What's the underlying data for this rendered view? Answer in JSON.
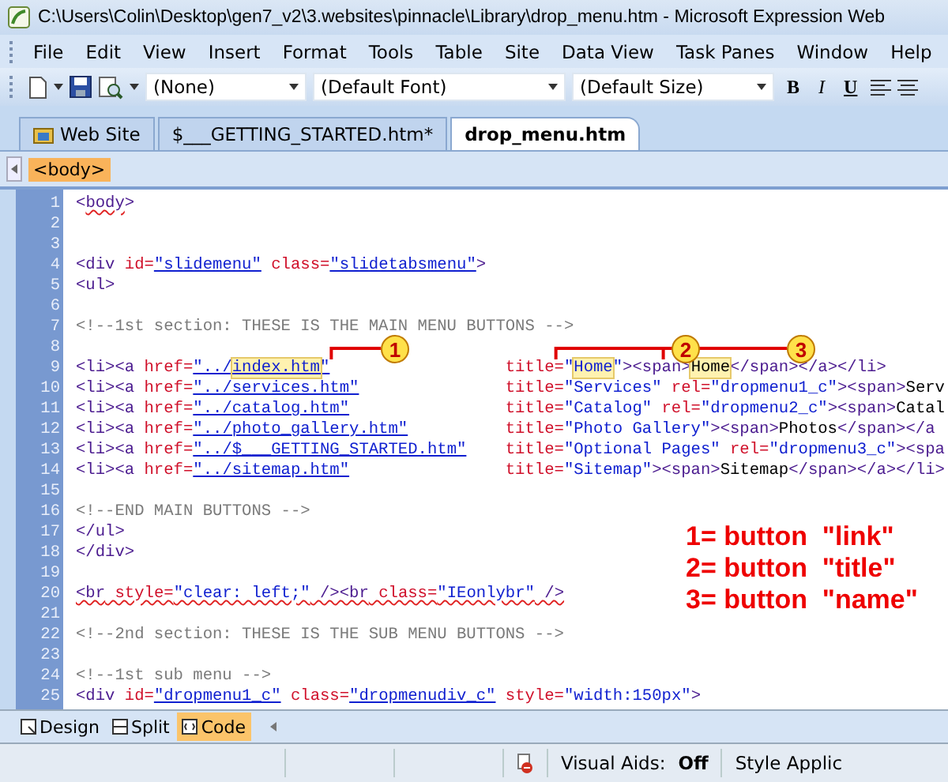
{
  "window": {
    "title": "C:\\Users\\Colin\\Desktop\\gen7_v2\\3.websites\\pinnacle\\Library\\drop_menu.htm - Microsoft Expression Web"
  },
  "menu": [
    "File",
    "Edit",
    "View",
    "Insert",
    "Format",
    "Tools",
    "Table",
    "Site",
    "Data View",
    "Task Panes",
    "Window",
    "Help"
  ],
  "toolbar": {
    "style": "(None)",
    "font": "(Default Font)",
    "size": "(Default Size)",
    "format_buttons": [
      "B",
      "I",
      "U"
    ]
  },
  "tabs": [
    {
      "label": "Web Site",
      "kind": "site",
      "selected": false
    },
    {
      "label": "$___GETTING_STARTED.htm*",
      "kind": "file",
      "selected": false
    },
    {
      "label": "drop_menu.htm",
      "kind": "file",
      "selected": true
    }
  ],
  "breadcrumb": "<body>",
  "code_lines": [
    {
      "n": "1",
      "segments": [
        {
          "kind": "tag",
          "text": "<"
        },
        {
          "kind": "tag",
          "text": "body",
          "squiggle": true
        },
        {
          "kind": "tag",
          "text": ">"
        }
      ]
    },
    {
      "n": "2"
    },
    {
      "n": "3"
    },
    {
      "n": "4",
      "segments": [
        {
          "kind": "tag",
          "text": "<div"
        },
        {
          "kind": "attr",
          "text": " id="
        },
        {
          "kind": "link",
          "text": "\"slidemenu\""
        },
        {
          "kind": "attr",
          "text": " class="
        },
        {
          "kind": "link",
          "text": "\"slidetabsmenu\""
        },
        {
          "kind": "tag",
          "text": ">"
        }
      ]
    },
    {
      "n": "5",
      "segments": [
        {
          "kind": "tag",
          "text": "<ul>"
        }
      ]
    },
    {
      "n": "6"
    },
    {
      "n": "7",
      "segments": [
        {
          "kind": "comment",
          "text": "<!--1st section: THESE IS THE MAIN MENU BUTTONS -->"
        }
      ]
    },
    {
      "n": "8"
    },
    {
      "n": "9",
      "segments": [
        {
          "kind": "tag",
          "text": "<li><a"
        },
        {
          "kind": "attr",
          "text": " href="
        },
        {
          "kind": "link",
          "text": "\"../"
        },
        {
          "kind": "link",
          "text": "index.htm",
          "highlight": true
        },
        {
          "kind": "link",
          "text": "\""
        }
      ],
      "column_2": [
        {
          "kind": "attr",
          "text": "title="
        },
        {
          "kind": "value",
          "text": "\""
        },
        {
          "kind": "value",
          "text": "Home",
          "highlight": true
        },
        {
          "kind": "value",
          "text": "\""
        },
        {
          "kind": "tag",
          "text": "><span>"
        },
        {
          "kind": "text",
          "text": "Home",
          "highlight": true
        },
        {
          "kind": "tag",
          "text": "</span></a></li>"
        }
      ]
    },
    {
      "n": "10",
      "segments": [
        {
          "kind": "tag",
          "text": "<li><a"
        },
        {
          "kind": "attr",
          "text": " href="
        },
        {
          "kind": "link",
          "text": "\"../services.htm\""
        }
      ],
      "column_2": [
        {
          "kind": "attr",
          "text": "title="
        },
        {
          "kind": "value",
          "text": "\"Services\""
        },
        {
          "kind": "attr",
          "text": " rel="
        },
        {
          "kind": "value",
          "text": "\"dropmenu1_c\""
        },
        {
          "kind": "tag",
          "text": "><span>"
        },
        {
          "kind": "text",
          "text": "Serv"
        }
      ]
    },
    {
      "n": "11",
      "segments": [
        {
          "kind": "tag",
          "text": "<li><a"
        },
        {
          "kind": "attr",
          "text": " href="
        },
        {
          "kind": "link",
          "text": "\"../catalog.htm\""
        }
      ],
      "column_2": [
        {
          "kind": "attr",
          "text": "title="
        },
        {
          "kind": "value",
          "text": "\"Catalog\""
        },
        {
          "kind": "attr",
          "text": " rel="
        },
        {
          "kind": "value",
          "text": "\"dropmenu2_c\""
        },
        {
          "kind": "tag",
          "text": "><span>"
        },
        {
          "kind": "text",
          "text": "Catal"
        }
      ]
    },
    {
      "n": "12",
      "segments": [
        {
          "kind": "tag",
          "text": "<li><a"
        },
        {
          "kind": "attr",
          "text": " href="
        },
        {
          "kind": "link",
          "text": "\"../photo_gallery.htm\""
        }
      ],
      "column_2": [
        {
          "kind": "attr",
          "text": "title="
        },
        {
          "kind": "value",
          "text": "\"Photo Gallery\""
        },
        {
          "kind": "tag",
          "text": "><span>"
        },
        {
          "kind": "text",
          "text": "Photos"
        },
        {
          "kind": "tag",
          "text": "</span></a"
        }
      ]
    },
    {
      "n": "13",
      "segments": [
        {
          "kind": "tag",
          "text": "<li><a"
        },
        {
          "kind": "attr",
          "text": " href="
        },
        {
          "kind": "link",
          "text": "\"../$___GETTING_STARTED.htm\""
        }
      ],
      "column_2": [
        {
          "kind": "attr",
          "text": "title="
        },
        {
          "kind": "value",
          "text": "\"Optional Pages\""
        },
        {
          "kind": "attr",
          "text": " rel="
        },
        {
          "kind": "value",
          "text": "\"dropmenu3_c\""
        },
        {
          "kind": "tag",
          "text": "><spa"
        }
      ]
    },
    {
      "n": "14",
      "segments": [
        {
          "kind": "tag",
          "text": "<li><a"
        },
        {
          "kind": "attr",
          "text": " href="
        },
        {
          "kind": "link",
          "text": "\"../sitemap.htm\""
        }
      ],
      "column_2": [
        {
          "kind": "attr",
          "text": "title="
        },
        {
          "kind": "value",
          "text": "\"Sitemap\""
        },
        {
          "kind": "tag",
          "text": "><span>"
        },
        {
          "kind": "text",
          "text": "Sitemap"
        },
        {
          "kind": "tag",
          "text": "</span></a></li>"
        }
      ]
    },
    {
      "n": "15"
    },
    {
      "n": "16",
      "segments": [
        {
          "kind": "comment",
          "text": "<!--END MAIN BUTTONS -->"
        }
      ]
    },
    {
      "n": "17",
      "segments": [
        {
          "kind": "tag",
          "text": "</ul>"
        }
      ]
    },
    {
      "n": "18",
      "segments": [
        {
          "kind": "tag",
          "text": "</div>"
        }
      ]
    },
    {
      "n": "19"
    },
    {
      "n": "20",
      "segments": [
        {
          "kind": "tag",
          "text": "<br",
          "squiggle": true
        },
        {
          "kind": "attr",
          "text": " style=",
          "squiggle": true
        },
        {
          "kind": "value",
          "text": "\"clear: left;\"",
          "squiggle": true
        },
        {
          "kind": "tag",
          "text": " /><br",
          "squiggle": true
        },
        {
          "kind": "attr",
          "text": " class=",
          "squiggle": true
        },
        {
          "kind": "value",
          "text": "\"IEonlybr\"",
          "squiggle": true
        },
        {
          "kind": "tag",
          "text": " />",
          "squiggle": true
        }
      ]
    },
    {
      "n": "21"
    },
    {
      "n": "22",
      "segments": [
        {
          "kind": "comment",
          "text": "<!--2nd section: THESE IS THE SUB MENU BUTTONS -->"
        }
      ]
    },
    {
      "n": "23"
    },
    {
      "n": "24",
      "segments": [
        {
          "kind": "comment",
          "text": "<!--1st sub menu -->"
        }
      ]
    },
    {
      "n": "25",
      "segments": [
        {
          "kind": "tag",
          "text": "<div"
        },
        {
          "kind": "attr",
          "text": " id="
        },
        {
          "kind": "link",
          "text": "\"dropmenu1_c\""
        },
        {
          "kind": "attr",
          "text": " class="
        },
        {
          "kind": "link",
          "text": "\"dropmenudiv_c\""
        },
        {
          "kind": "attr",
          "text": " style="
        },
        {
          "kind": "value",
          "text": "\"width:150px\""
        },
        {
          "kind": "tag",
          "text": ">"
        }
      ]
    }
  ],
  "callouts": [
    "1",
    "2",
    "3"
  ],
  "legend": [
    "1= button  \"link\"",
    "2= button  \"title\"",
    "3= button  \"name\""
  ],
  "view_tabs": [
    {
      "label": "Design",
      "kind": "design",
      "selected": false
    },
    {
      "label": "Split",
      "kind": "split",
      "selected": false
    },
    {
      "label": "Code",
      "kind": "code",
      "selected": true
    }
  ],
  "status_bar": {
    "visual_aids_label": "Visual Aids:",
    "visual_aids_value": "Off",
    "style_label": "Style Applic"
  }
}
